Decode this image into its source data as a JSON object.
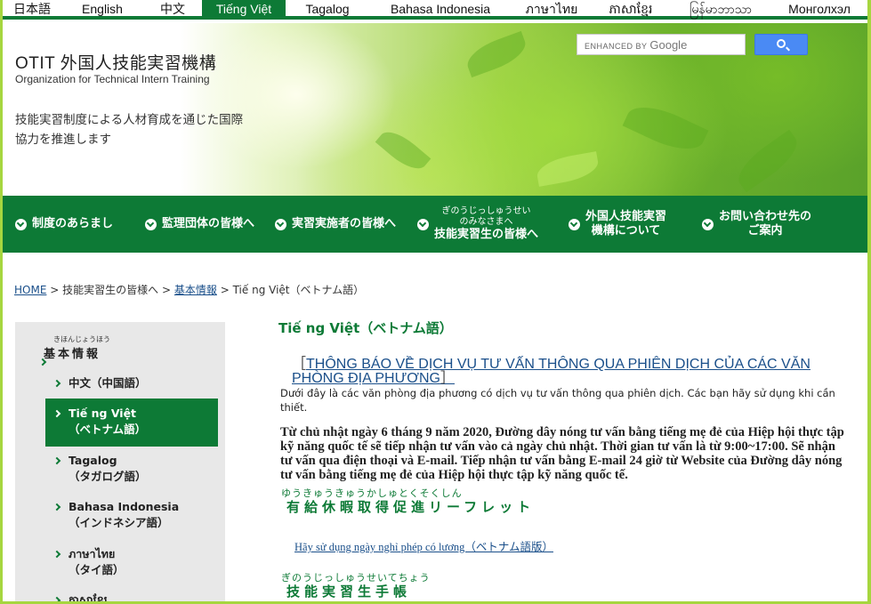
{
  "languages": [
    {
      "label": "日本語",
      "active": false
    },
    {
      "label": "English",
      "active": false
    },
    {
      "label": "中文",
      "active": false
    },
    {
      "label": "Tiếng Việt",
      "active": true
    },
    {
      "label": "Tagalog",
      "active": false
    },
    {
      "label": "Bahasa Indonesia",
      "active": false
    },
    {
      "label": "ภาษาไทย",
      "active": false
    },
    {
      "label": "ភាសាខ្មែរ",
      "active": false
    },
    {
      "label": "မြန်မာဘာသာ",
      "active": false
    },
    {
      "label": "Монголхэл",
      "active": false
    }
  ],
  "header": {
    "logo_title": "OTIT 外国人技能実習機構",
    "logo_subtitle": "Organization for Technical Intern Training",
    "tagline": "技能実習制度による人材育成を通じた国際協力を推進します",
    "search_prefix": "ENHANCED BY",
    "search_brand": "Google"
  },
  "nav": [
    {
      "label": "制度のあらまし"
    },
    {
      "label": "監理団体の皆様へ"
    },
    {
      "label": "実習実施者の皆様へ"
    },
    {
      "ruby": "ぎのうじっしゅうせい",
      "ruby2": "のみなさまへ",
      "label": "技能実習生の皆様へ"
    },
    {
      "label": "外国人技能実習",
      "label2": "機構について"
    },
    {
      "label": "お問い合わせ先の",
      "label2": "ご案内"
    }
  ],
  "breadcrumb": {
    "home": "HOME",
    "sep": ">",
    "level2": "技能実習生の皆様へ",
    "level3": "基本情報",
    "current": "Tiế ng Việt（ベトナム語）"
  },
  "sidebar": {
    "heading_furigana": "きほんじょうほう",
    "heading": "基本情報",
    "items": [
      {
        "label": "中文（中国語）",
        "sub": ""
      },
      {
        "label": "Tiế ng Việt",
        "sub": "（ベトナム語）",
        "active": true
      },
      {
        "label": "Tagalog",
        "sub": "（タガログ語）"
      },
      {
        "label": "Bahasa Indonesia",
        "sub": "（インドネシア語）"
      },
      {
        "label": "ภาษาไทย",
        "sub": "（タイ語）"
      },
      {
        "label": "ភាសាខ្មែរ",
        "sub": ""
      }
    ]
  },
  "main": {
    "title": "Tiế ng Việt（ベトナム語）",
    "notice_open": "［",
    "notice_link": "THÔNG BÁO VỀ DỊCH VỤ TƯ VẤN THÔNG QUA PHIÊN DỊCH CỦA CÁC VĂN PHÒNG ĐỊA PHƯƠNG",
    "notice_close": "］",
    "note": "Dưới đây là các văn phòng địa phương có dịch vụ tư vấn thông qua phiên dịch. Các bạn hãy sử dụng khi cần thiết.",
    "paragraph": "Từ chủ nhật ngày 6 tháng 9 năm 2020, Đường dây nóng tư vấn bằng tiếng mẹ đẻ của Hiệp hội thực tập kỹ năng quốc tế sẽ tiếp nhận tư vấn vào cả ngày chủ nhật. Thời gian tư vấn là từ 9:00~17:00. Sẽ nhận tư vấn qua điện thoại và E-mail. Tiếp nhận tư vấn bằng E-mail 24 giờ từ Website của Đường dây nóng tư vấn bằng tiếng mẹ đẻ của Hiệp hội thực tập kỹ năng quốc tế.",
    "leave_furigana": "ゆうきゅうきゅうかしゅとくそくしん",
    "leave_heading": "有給休暇取得促進リーフレット",
    "leave_link": "Hãy sử dụng ngày nghỉ phép có lương（ベトナム語版）",
    "handbook_furigana": "ぎのうじっしゅうせいてちょう",
    "handbook_heading": "技能実習生手帳"
  }
}
